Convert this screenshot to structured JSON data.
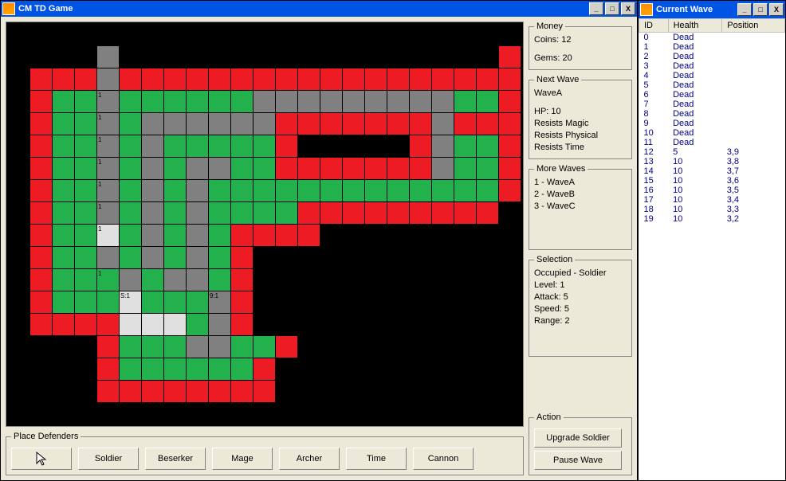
{
  "main": {
    "title": "CM TD Game",
    "money": {
      "legend": "Money",
      "coins_label": "Coins:",
      "coins": "12",
      "gems_label": "Gems:",
      "gems": "20"
    },
    "nextwave": {
      "legend": "Next Wave",
      "name": "WaveA",
      "hp_label": "HP:",
      "hp": "10",
      "r1": "Resists Magic",
      "r2": "Resists Physical",
      "r3": "Resists Time"
    },
    "morewaves": {
      "legend": "More Waves",
      "w1": "1 - WaveA",
      "w2": "2 - WaveB",
      "w3": "3 - WaveC"
    },
    "selection": {
      "legend": "Selection",
      "occ": "Occupied - Soldier",
      "lvl": "Level: 1",
      "atk": "Attack: 5",
      "spd": "Speed: 5",
      "rng": "Range: 2"
    },
    "action": {
      "legend": "Action",
      "upgrade": "Upgrade Soldier",
      "pause": "Pause Wave"
    },
    "defenders": {
      "legend": "Place Defenders",
      "b1": "Soldier",
      "b2": "Beserker",
      "b3": "Mage",
      "b4": "Archer",
      "b5": "Time",
      "b6": "Cannon"
    },
    "grid_labels": {
      "one": "1",
      "s1": "S:1",
      "nine": "9:1"
    }
  },
  "wave": {
    "title": "Current Wave",
    "headers": {
      "id": "ID",
      "health": "Health",
      "pos": "Position"
    },
    "rows": [
      {
        "id": "0",
        "h": "Dead",
        "p": ""
      },
      {
        "id": "1",
        "h": "Dead",
        "p": ""
      },
      {
        "id": "2",
        "h": "Dead",
        "p": ""
      },
      {
        "id": "3",
        "h": "Dead",
        "p": ""
      },
      {
        "id": "4",
        "h": "Dead",
        "p": ""
      },
      {
        "id": "5",
        "h": "Dead",
        "p": ""
      },
      {
        "id": "6",
        "h": "Dead",
        "p": ""
      },
      {
        "id": "7",
        "h": "Dead",
        "p": ""
      },
      {
        "id": "8",
        "h": "Dead",
        "p": ""
      },
      {
        "id": "9",
        "h": "Dead",
        "p": ""
      },
      {
        "id": "10",
        "h": "Dead",
        "p": ""
      },
      {
        "id": "11",
        "h": "Dead",
        "p": ""
      },
      {
        "id": "12",
        "h": "5",
        "p": "3,9"
      },
      {
        "id": "13",
        "h": "10",
        "p": "3,8"
      },
      {
        "id": "14",
        "h": "10",
        "p": "3,7"
      },
      {
        "id": "15",
        "h": "10",
        "p": "3,6"
      },
      {
        "id": "16",
        "h": "10",
        "p": "3,5"
      },
      {
        "id": "17",
        "h": "10",
        "p": "3,4"
      },
      {
        "id": "18",
        "h": "10",
        "p": "3,3"
      },
      {
        "id": "19",
        "h": "10",
        "p": "3,2"
      }
    ]
  },
  "grid_map": [
    "kkkkkkkkkkkkkkkkkkkkkkk",
    "kkkkykkkkkkkkkkkkkkkkkr",
    "krrryrrrrrrrrrrrrrrrrrr",
    "krggyggggggyyyyyyyyyggr",
    "krggygyyyyyyrrrrrrryrrr",
    "krggygygggggrkkkkkryggr",
    "krggygygyyggrrrrrrryggr",
    "krggygygygggggggggggggr",
    "krggygygyggggrrrrrrrrrk",
    "krggwgygygrrrrkkkkkkkkk",
    "krggygygygrkkkkkkkkkkkk",
    "krgggygyygrkkkkkkkkkkkk",
    "krgggwgggyrkkkkkkkkkkkk",
    "krrrrwwwgyrkkkkkkkkkkkk",
    "kkkkrgggyyggrkkkkkkkkkk",
    "kkkkrggggggrkkkkkkkkkkk",
    "kkkkrrrrrrrrkkkkkkkkkkk",
    "kkkkkkkkkkkkkkkkkkkkkkk"
  ],
  "grid_labels_at": {
    "4,3": "one",
    "4,4": "one",
    "4,5": "one",
    "4,6": "one",
    "4,7": "one",
    "4,8": "one",
    "4,9": "one",
    "4,11": "one",
    "5,12": "s1",
    "9,12": "nine"
  }
}
